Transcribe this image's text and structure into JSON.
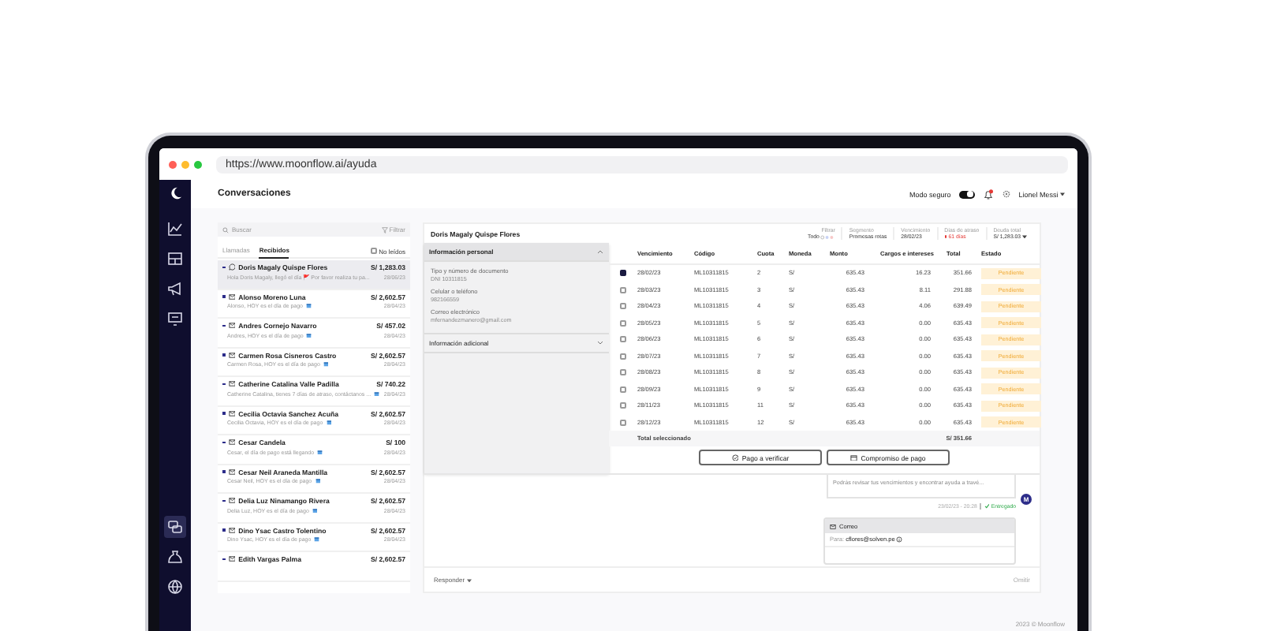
{
  "browser": {
    "url": "https://www.moonflow.ai/ayuda"
  },
  "sidebar": {
    "items": [
      {
        "selected": false
      },
      {
        "selected": false
      },
      {
        "selected": false
      },
      {
        "selected": false
      },
      {
        "selected": true
      },
      {
        "selected": false
      },
      {
        "selected": false
      }
    ]
  },
  "header": {
    "title": "Conversaciones",
    "safe_mode": {
      "label": "Modo seguro",
      "on": true
    },
    "notifications": {
      "unread": true
    },
    "user": "Lionel Messi"
  },
  "conversations": {
    "search": {
      "placeholder": "Buscar"
    },
    "filter": "Filtrar",
    "tabs": [
      {
        "label": "Llamadas",
        "selected": false
      },
      {
        "label": "Recibidos",
        "selected": true
      }
    ],
    "unread_only": {
      "label": "No leídos",
      "checked": false
    },
    "items": [
      {
        "name": "Doris Magaly Quispe Flores",
        "amount": "S/ 1,283.03",
        "preview": "Hola Doris Magaly, llegó el día 🚩 Por favor realiza tu pa...",
        "date": "28/06/23",
        "kind": "whatsapp",
        "selected": true
      },
      {
        "name": "Alonso Moreno Luna",
        "amount": "S/ 2,602.57",
        "preview": "Alonso, HOY es el día de pago",
        "date": "28/04/23",
        "kind": "email",
        "selected": false
      },
      {
        "name": "Andres Cornejo Navarro",
        "amount": "S/ 457.02",
        "preview": "Andres, HOY es el día de pago",
        "date": "28/04/23",
        "kind": "email",
        "selected": false
      },
      {
        "name": "Carmen Rosa Cisneros Castro",
        "amount": "S/ 2,602.57",
        "preview": "Carmen Rosa, HOY es el día de pago",
        "date": "28/04/23",
        "kind": "email",
        "selected": false
      },
      {
        "name": "Catherine Catalina Valle Padilla",
        "amount": "S/ 740.22",
        "preview": "Catherine Catalina, tienes 7 días de atraso, contáctanos ...",
        "date": "28/04/23",
        "kind": "email",
        "selected": false
      },
      {
        "name": "Cecilia Octavia Sanchez Acuña",
        "amount": "S/ 2,602.57",
        "preview": "Cecilia Octavia, HOY es el día de pago",
        "date": "28/04/23",
        "kind": "email",
        "selected": false
      },
      {
        "name": "Cesar Candela",
        "amount": "S/ 100",
        "preview": "Cesar, el día de pago está llegando",
        "date": "28/04/23",
        "kind": "email",
        "selected": false
      },
      {
        "name": "Cesar Neil Araneda Mantilla",
        "amount": "S/ 2,602.57",
        "preview": "Cesar Neil, HOY es el día de pago",
        "date": "28/04/23",
        "kind": "email",
        "selected": false
      },
      {
        "name": "Delia Luz Ninamango Rivera",
        "amount": "S/ 2,602.57",
        "preview": "Delia Luz, HOY es el día de pago",
        "date": "28/04/23",
        "kind": "email",
        "selected": false
      },
      {
        "name": "Dino Ysac Castro Tolentino",
        "amount": "S/ 2,602.57",
        "preview": "Dino Ysac, HOY es el día de pago",
        "date": "28/04/23",
        "kind": "email",
        "selected": false
      },
      {
        "name": "Edith Vargas Palma",
        "amount": "S/ 2,602.57",
        "kind": "email",
        "selected": false
      }
    ]
  },
  "detail": {
    "customer": "Doris Magaly Quispe Flores",
    "stats": [
      {
        "label": "Filtrar",
        "value": "Todo",
        "kind": "filter"
      },
      {
        "label": "Segmento",
        "value": "Promesas rotas",
        "kind": "plain"
      },
      {
        "label": "Vencimiento",
        "value": "28/02/23",
        "kind": "plain"
      },
      {
        "label": "Días de atraso",
        "value": "61 días",
        "kind": "alert",
        "color": "#e53935"
      },
      {
        "label": "Deuda total",
        "value": "S/ 1,283.03",
        "kind": "dropdown"
      }
    ],
    "sections": [
      {
        "title": "Información personal",
        "expanded": true,
        "fields": [
          {
            "label": "Tipo y número de documento",
            "value": "DNI 10311815"
          },
          {
            "label": "Celular o teléfono",
            "value": "982166559"
          },
          {
            "label": "Correo electrónico",
            "value": "mfernandezmanero@gmail.com"
          }
        ]
      },
      {
        "title": "Información adicional",
        "expanded": false
      }
    ],
    "table": {
      "columns": [
        "Vencimiento",
        "Código",
        "Cuota",
        "Moneda",
        "Monto",
        "Cargos e intereses",
        "Total",
        "Estado"
      ],
      "rows": [
        {
          "checked": true,
          "cells": [
            "28/02/23",
            "ML10311815",
            "2",
            "S/",
            "635.43",
            "16.23",
            "351.66"
          ],
          "status": "Pendiente"
        },
        {
          "checked": false,
          "cells": [
            "28/03/23",
            "ML10311815",
            "3",
            "S/",
            "635.43",
            "8.11",
            "291.88"
          ],
          "status": "Pendiente"
        },
        {
          "checked": false,
          "cells": [
            "28/04/23",
            "ML10311815",
            "4",
            "S/",
            "635.43",
            "4.06",
            "639.49"
          ],
          "status": "Pendiente"
        },
        {
          "checked": false,
          "cells": [
            "28/05/23",
            "ML10311815",
            "5",
            "S/",
            "635.43",
            "0.00",
            "635.43"
          ],
          "status": "Pendiente"
        },
        {
          "checked": false,
          "cells": [
            "28/06/23",
            "ML10311815",
            "6",
            "S/",
            "635.43",
            "0.00",
            "635.43"
          ],
          "status": "Pendiente"
        },
        {
          "checked": false,
          "cells": [
            "28/07/23",
            "ML10311815",
            "7",
            "S/",
            "635.43",
            "0.00",
            "635.43"
          ],
          "status": "Pendiente"
        },
        {
          "checked": false,
          "cells": [
            "28/08/23",
            "ML10311815",
            "8",
            "S/",
            "635.43",
            "0.00",
            "635.43"
          ],
          "status": "Pendiente"
        },
        {
          "checked": false,
          "cells": [
            "28/09/23",
            "ML10311815",
            "9",
            "S/",
            "635.43",
            "0.00",
            "635.43"
          ],
          "status": "Pendiente"
        },
        {
          "checked": false,
          "cells": [
            "28/11/23",
            "ML10311815",
            "11",
            "S/",
            "635.43",
            "0.00",
            "635.43"
          ],
          "status": "Pendiente"
        },
        {
          "checked": false,
          "cells": [
            "28/12/23",
            "ML10311815",
            "12",
            "S/",
            "635.43",
            "0.00",
            "635.43"
          ],
          "status": "Pendiente"
        }
      ],
      "total_label": "Total seleccionado",
      "total_value": "S/ 351.66"
    },
    "actions": [
      {
        "label": "Pago a verificar",
        "kind": "check"
      },
      {
        "label": "Compromiso de pago",
        "kind": "calendar"
      }
    ],
    "chat": {
      "message": "Podrás revisar tus vencimientos y encontrar ayuda a travé...",
      "avatar": "M",
      "time": "23/02/23 - 20:28",
      "status": "Entregado",
      "email_title": "Correo",
      "to_label": "Para:",
      "to": "cflores@solven.pe"
    },
    "reply": "Responder",
    "skip": "Omitir"
  },
  "footer": "2023 © Moonflow"
}
